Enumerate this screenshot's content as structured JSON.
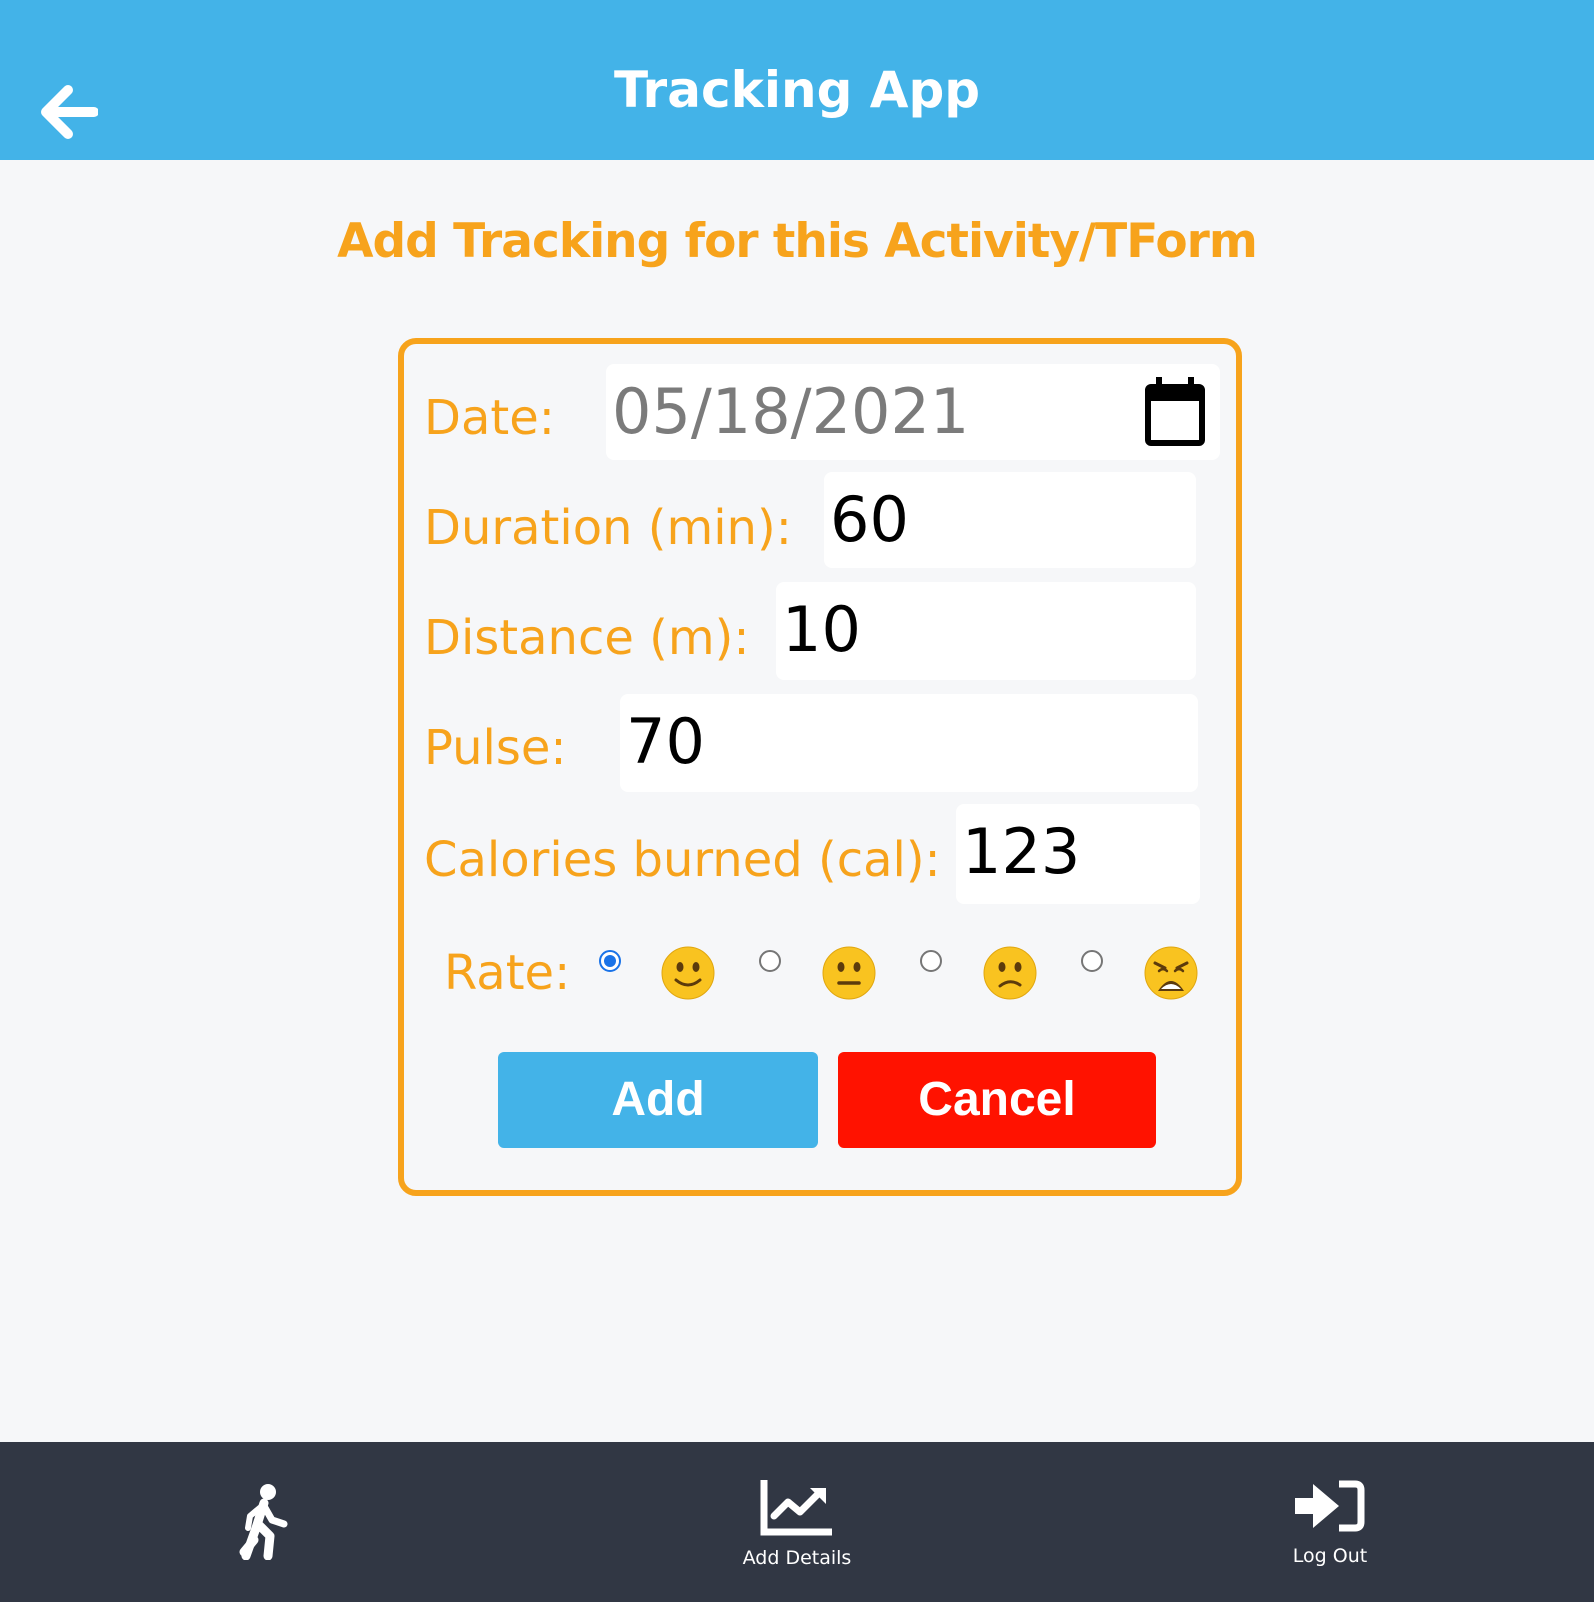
{
  "header": {
    "title": "Tracking App",
    "back_icon": "arrow-left-icon"
  },
  "page": {
    "heading": "Add Tracking for this Activity/TForm"
  },
  "form": {
    "date_label": "Date:",
    "date_value": "05/18/2021",
    "duration_label": "Duration (min):",
    "duration_value": "60",
    "distance_label": "Distance (m):",
    "distance_value": "10",
    "pulse_label": "Pulse:",
    "pulse_value": "70",
    "calories_label": "Calories burned (cal):",
    "calories_value": "123",
    "rate_label": "Rate:",
    "rate_options": [
      {
        "icon": "slightly-smiling-face-icon",
        "selected": true
      },
      {
        "icon": "neutral-face-icon",
        "selected": false
      },
      {
        "icon": "confused-face-icon",
        "selected": false
      },
      {
        "icon": "weary-face-icon",
        "selected": false
      }
    ],
    "add_label": "Add",
    "cancel_label": "Cancel"
  },
  "bottom_nav": {
    "items": [
      {
        "icon": "walking-person-icon",
        "label": ""
      },
      {
        "icon": "chart-line-icon",
        "label": "Add Details"
      },
      {
        "icon": "sign-in-icon",
        "label": "Log Out"
      }
    ]
  },
  "colors": {
    "header_bg": "#43b3e8",
    "accent_orange": "#f7a31c",
    "add_button": "#43b3e8",
    "cancel_button": "#ff1200",
    "bottom_bar": "#313744",
    "radio_selected": "#1a73e8"
  }
}
